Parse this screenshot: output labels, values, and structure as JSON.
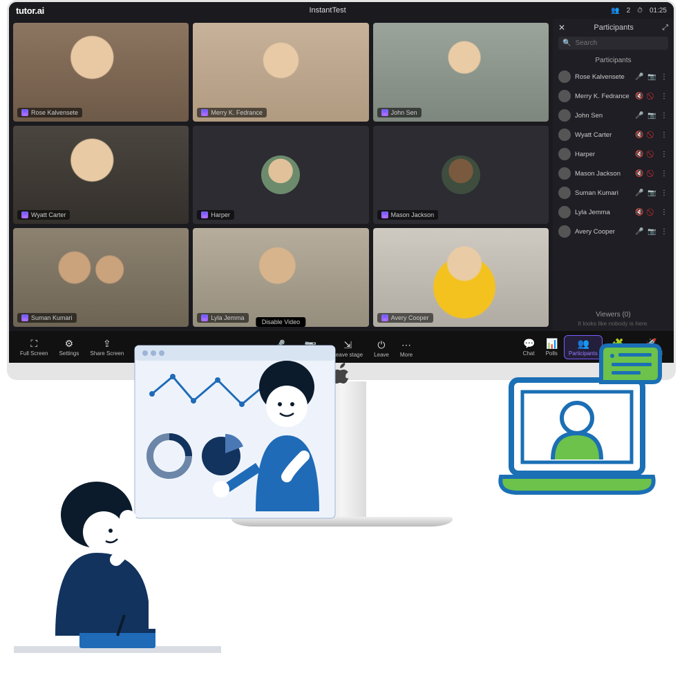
{
  "brand": "tutor.ai",
  "header": {
    "title": "InstantTest",
    "participants_count": "2",
    "timer": "01:25"
  },
  "grid_hover_label": "Disable Video",
  "participants_panel": {
    "title": "Participants",
    "search_placeholder": "Search",
    "section_label": "Participants",
    "viewers_label": "Viewers (0)",
    "viewers_note": "It looks like nobody is here."
  },
  "participants": [
    {
      "name": "Rose Kalvensete",
      "mic_muted": false,
      "cam_off": false
    },
    {
      "name": "Merry K. Fedrance",
      "mic_muted": true,
      "cam_off": true
    },
    {
      "name": "John Sen",
      "mic_muted": false,
      "cam_off": false
    },
    {
      "name": "Wyatt  Carter",
      "mic_muted": true,
      "cam_off": true
    },
    {
      "name": "Harper",
      "mic_muted": true,
      "cam_off": true
    },
    {
      "name": "Mason Jackson",
      "mic_muted": true,
      "cam_off": true
    },
    {
      "name": "Suman Kumari",
      "mic_muted": false,
      "cam_off": false
    },
    {
      "name": "Lyla Jemma",
      "mic_muted": true,
      "cam_off": true
    },
    {
      "name": "Avery Cooper",
      "mic_muted": false,
      "cam_off": false
    }
  ],
  "tiles": [
    {
      "name": "Rose Kalvensete",
      "has_video": true,
      "bg": "ph1"
    },
    {
      "name": "Merry K. Fedrance",
      "has_video": true,
      "bg": "ph2"
    },
    {
      "name": "John Sen",
      "has_video": true,
      "bg": "ph3"
    },
    {
      "name": "Wyatt  Carter",
      "has_video": true,
      "bg": "ph4"
    },
    {
      "name": "Harper",
      "has_video": false,
      "bg": "avph5"
    },
    {
      "name": "Mason Jackson",
      "has_video": false,
      "bg": "avph6"
    },
    {
      "name": "Suman Kumari",
      "has_video": true,
      "bg": "ph7"
    },
    {
      "name": "Lyla Jemma",
      "has_video": true,
      "bg": "ph8"
    },
    {
      "name": "Avery Cooper",
      "has_video": true,
      "bg": "ph9"
    }
  ],
  "toolbar": {
    "left": [
      {
        "id": "fullscreen",
        "label": "Full Screen"
      },
      {
        "id": "settings",
        "label": "Settings"
      },
      {
        "id": "share",
        "label": "Share Screen"
      }
    ],
    "center": [
      {
        "id": "mic",
        "label": "Mic On"
      },
      {
        "id": "video",
        "label": "Video On"
      },
      {
        "id": "leavestage",
        "label": "Leave stage"
      },
      {
        "id": "leave",
        "label": "Leave"
      },
      {
        "id": "more",
        "label": "More"
      }
    ],
    "right": [
      {
        "id": "chat",
        "label": "Chat"
      },
      {
        "id": "polls",
        "label": "Polls"
      },
      {
        "id": "participants",
        "label": "Participants",
        "active": true
      },
      {
        "id": "plugins",
        "label": "Plugins"
      },
      {
        "id": "meetingai",
        "label": "MeetingAI"
      }
    ]
  }
}
